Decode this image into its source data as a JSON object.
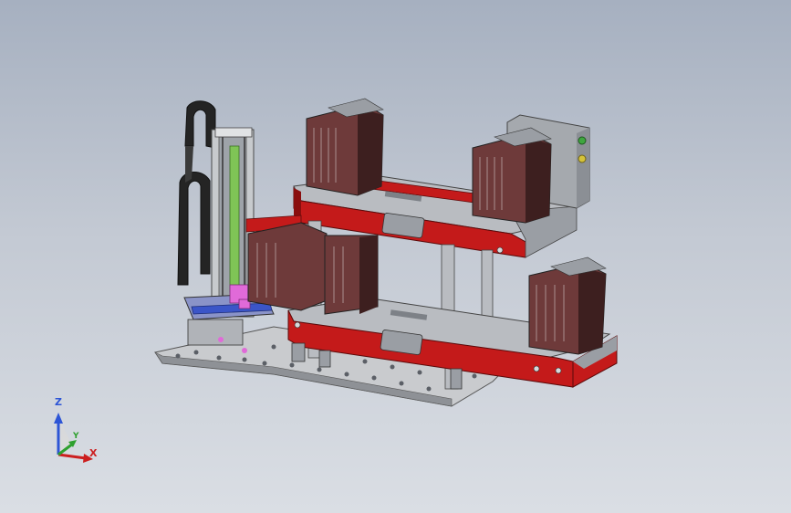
{
  "viewport": {
    "model_name": "",
    "colors": {
      "frame_red": "#c41a1a",
      "frame_red_dark": "#8a0e0e",
      "steel": "#b9bcc1",
      "steel_dark": "#7d8187",
      "magazine": "#6e3a3a",
      "magazine_dark": "#3d1f1f",
      "cable_chain": "#2a2a2a",
      "rail_blue": "#3b55c8",
      "rail_green": "#7fc456",
      "accent_pink": "#e06ad8",
      "accent_green_led": "#3fa63f",
      "accent_yellow_led": "#d4c23a"
    }
  },
  "triad": {
    "z_label": "Z",
    "y_label": "Y",
    "x_label": "X",
    "z_color": "#2d55d6",
    "y_color": "#2ea02e",
    "x_color": "#cc1f1f"
  }
}
